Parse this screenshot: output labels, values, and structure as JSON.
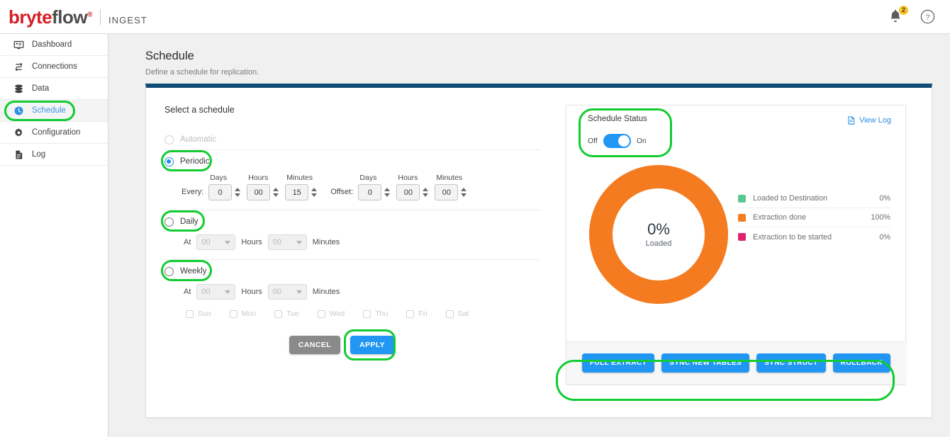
{
  "brand": {
    "logo_part1": "b",
    "logo_part2": "ryte",
    "logo_part3": "flow",
    "registered": "®",
    "product": "INGEST"
  },
  "topbar": {
    "notification_count": "2",
    "bell_icon": "bell-icon",
    "help_icon": "help-circle-icon"
  },
  "sidebar": {
    "items": [
      {
        "label": "Dashboard",
        "icon": "monitor-icon",
        "active": false
      },
      {
        "label": "Connections",
        "icon": "connections-icon",
        "active": false
      },
      {
        "label": "Data",
        "icon": "database-icon",
        "active": false
      },
      {
        "label": "Schedule",
        "icon": "clock-icon",
        "active": true
      },
      {
        "label": "Configuration",
        "icon": "gear-icon",
        "active": false
      },
      {
        "label": "Log",
        "icon": "document-icon",
        "active": false
      }
    ]
  },
  "page": {
    "title": "Schedule",
    "subtitle": "Define a schedule for replication."
  },
  "form": {
    "heading": "Select a schedule",
    "options": {
      "automatic": {
        "label": "Automatic",
        "selected": false,
        "disabled": true
      },
      "periodic": {
        "label": "Periodic",
        "selected": true,
        "disabled": false
      },
      "daily": {
        "label": "Daily",
        "selected": false,
        "disabled": false
      },
      "weekly": {
        "label": "Weekly",
        "selected": false,
        "disabled": false
      }
    },
    "periodic": {
      "every_label": "Every:",
      "offset_label": "Offset:",
      "caption_days": "Days",
      "caption_hours": "Hours",
      "caption_minutes": "Minutes",
      "every_days": "0",
      "every_hours": "00",
      "every_minutes": "15",
      "offset_days": "0",
      "offset_hours": "00",
      "offset_minutes": "00"
    },
    "daily": {
      "at_label": "At",
      "hours_value": "00",
      "hours_label": "Hours",
      "minutes_value": "00",
      "minutes_label": "Minutes"
    },
    "weekly": {
      "at_label": "At",
      "hours_value": "00",
      "hours_label": "Hours",
      "minutes_value": "00",
      "minutes_label": "Minutes",
      "days": [
        {
          "label": "Sun",
          "checked": false
        },
        {
          "label": "Mon",
          "checked": false
        },
        {
          "label": "Tue",
          "checked": false
        },
        {
          "label": "Wed",
          "checked": false
        },
        {
          "label": "Thu",
          "checked": false
        },
        {
          "label": "Fri",
          "checked": false
        },
        {
          "label": "Sat",
          "checked": false
        }
      ]
    },
    "buttons": {
      "cancel": "CANCEL",
      "apply": "APPLY"
    }
  },
  "status_panel": {
    "title": "Schedule Status",
    "toggle_off_label": "Off",
    "toggle_on_label": "On",
    "toggle_state": "On",
    "view_log": "View Log",
    "view_log_icon": "document-icon",
    "actions": [
      {
        "label": "FULL EXTRACT"
      },
      {
        "label": "SYNC NEW TABLES"
      },
      {
        "label": "SYNC STRUCT"
      },
      {
        "label": "ROLLBACK"
      }
    ]
  },
  "chart_data": {
    "type": "pie",
    "title": "",
    "center_value": "0%",
    "center_label": "Loaded",
    "categories": [
      "Loaded to Destination",
      "Extraction done",
      "Extraction to be started"
    ],
    "values": [
      0,
      100,
      0
    ],
    "value_labels": [
      "0%",
      "100%",
      "0%"
    ],
    "colors": [
      "#5bc98f",
      "#f47b20",
      "#e0246e"
    ],
    "legend_position": "right",
    "donut": true
  }
}
